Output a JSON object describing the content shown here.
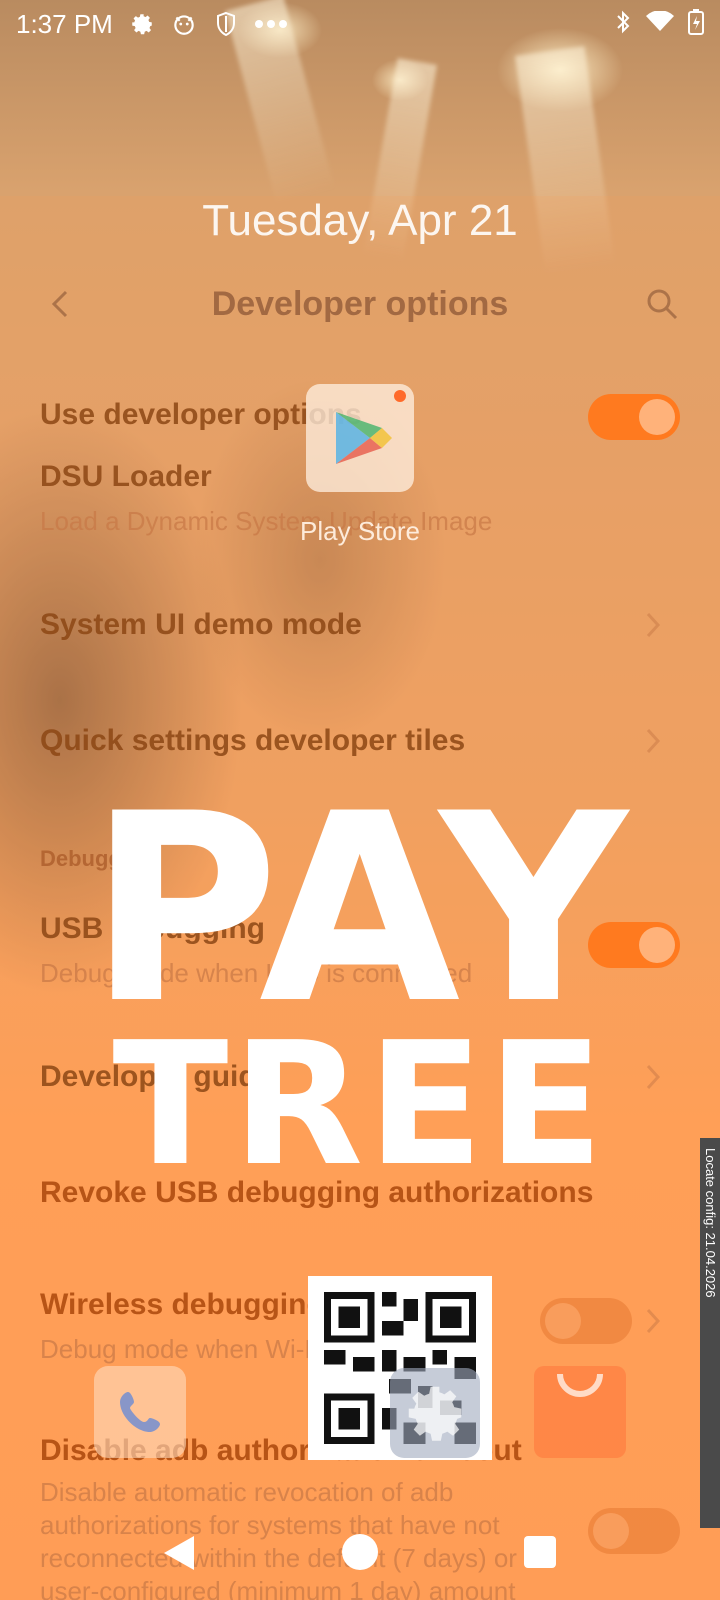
{
  "status_bar": {
    "time": "1:37 PM",
    "left_icons": [
      "gear-icon",
      "cat-face-icon",
      "shield-icon",
      "more-dots-icon"
    ],
    "right_icons": [
      "bluetooth-icon",
      "wifi-icon",
      "battery-charging-icon"
    ]
  },
  "lock_date": "Tuesday, Apr 21",
  "app_bar": {
    "title": "Developer options"
  },
  "settings": {
    "use_dev_options": {
      "title": "Use developer options",
      "enabled": true
    },
    "dsu_loader": {
      "title": "DSU Loader",
      "subtitle": "Load a Dynamic System Update Image"
    },
    "system_ui_demo": {
      "title": "System UI demo mode"
    },
    "quick_tiles": {
      "title": "Quick settings developer tiles"
    },
    "section_debugging": "Debugging",
    "usb_debugging": {
      "title": "USB debugging",
      "subtitle": "Debug mode when USB is connected",
      "enabled": true
    },
    "developer_guide": {
      "title": "Developer guide"
    },
    "revoke_usb": {
      "title": "Revoke USB debugging authorizations"
    },
    "wireless_debugging": {
      "title": "Wireless debugging",
      "subtitle": "Debug mode when Wi-Fi is connected",
      "enabled": false
    },
    "disable_adb_timeout": {
      "title": "Disable adb authorization timeout",
      "subtitle_lines": [
        "Disable automatic revocation of adb",
        "authorizations for systems that have not",
        "reconnected within the default (7 days) or",
        "user-configured (minimum 1 day) amount"
      ],
      "enabled": false
    }
  },
  "overlay": {
    "play_store_label": "Play Store",
    "brand_line1": "PAY",
    "brand_line2": "TREE",
    "side_tab_text": "Locate config: 21.04.2026"
  },
  "colors": {
    "accent": "#ff7a1f",
    "brand": "#ffffff"
  }
}
